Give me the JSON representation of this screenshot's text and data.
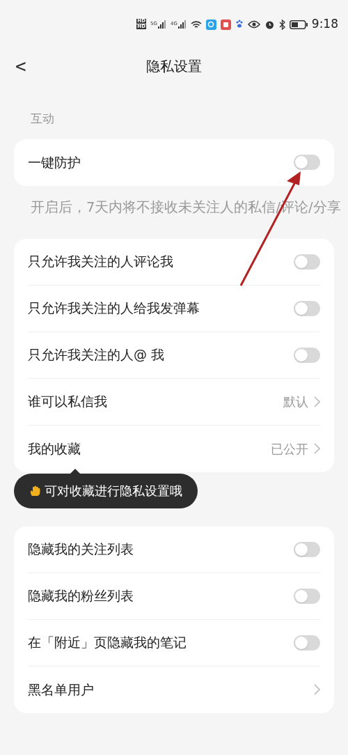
{
  "status_bar": {
    "sims": [
      "HD",
      "HD"
    ],
    "networks": [
      "5G",
      "4G"
    ],
    "time": "9:18"
  },
  "header": {
    "back": "<",
    "title": "隐私设置"
  },
  "sections": [
    {
      "title": "互动",
      "rows": [
        {
          "kind": "toggle",
          "label": "一键防护",
          "on": false
        }
      ],
      "note": "开启后，7天内将不接收未关注人的私信/评论/分享"
    },
    {
      "rows": [
        {
          "kind": "toggle",
          "label": "只允许我关注的人评论我",
          "on": false
        },
        {
          "kind": "toggle",
          "label": "只允许我关注的人给我发弹幕",
          "on": false
        },
        {
          "kind": "toggle",
          "label": "只允许我关注的人@ 我",
          "on": false
        },
        {
          "kind": "link",
          "label": "谁可以私信我",
          "value": "默认"
        },
        {
          "kind": "link",
          "label": "我的收藏",
          "value": "已公开"
        }
      ]
    },
    {
      "rows": [
        {
          "kind": "toggle",
          "label": "隐藏我的关注列表",
          "on": false
        },
        {
          "kind": "toggle",
          "label": "隐藏我的粉丝列表",
          "on": false
        },
        {
          "kind": "toggle",
          "label": "在「附近」页隐藏我的笔记",
          "on": false
        },
        {
          "kind": "link",
          "label": "黑名单用户"
        }
      ]
    }
  ],
  "tooltip": {
    "text": "可对收藏进行隐私设置哦"
  }
}
